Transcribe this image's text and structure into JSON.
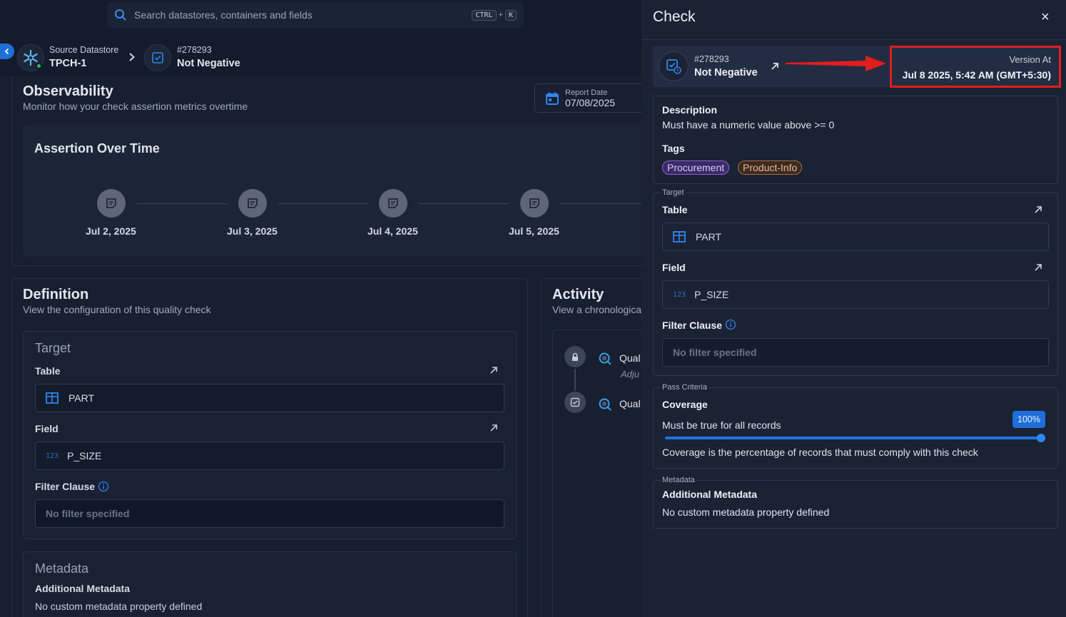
{
  "search": {
    "placeholder": "Search datastores, containers and fields",
    "key1": "CTRL",
    "plus": "+",
    "key2": "K"
  },
  "breadcrumb": {
    "datastore_label": "Source Datastore",
    "datastore_name": "TPCH-1",
    "check_id": "#278293",
    "check_name": "Not Negative"
  },
  "observability": {
    "title": "Observability",
    "subtitle": "Monitor how your check assertion metrics overtime",
    "report_date_label": "Report Date",
    "report_date_value": "07/08/2025",
    "assertion_title": "Assertion Over Time",
    "dates": [
      "Jul 2, 2025",
      "Jul 3, 2025",
      "Jul 4, 2025",
      "Jul 5, 2025"
    ]
  },
  "definition": {
    "title": "Definition",
    "subtitle": "View the configuration of this quality check",
    "target_title": "Target",
    "table_label": "Table",
    "table_value": "PART",
    "field_label": "Field",
    "field_type": "123",
    "field_value": "P_SIZE",
    "filter_label": "Filter Clause",
    "filter_placeholder": "No filter specified",
    "metadata_title": "Metadata",
    "metadata_label": "Additional Metadata",
    "metadata_value": "No custom metadata property defined"
  },
  "activity": {
    "title": "Activity",
    "subtitle": "View a chronologica",
    "item1": "Qual",
    "item1_sub": "Adju",
    "item2": "Qual"
  },
  "panel": {
    "title": "Check",
    "close": "×",
    "check_id": "#278293",
    "check_name": "Not Negative",
    "version_label": "Version At",
    "version_value": "Jul 8 2025, 5:42 AM (GMT+5:30)",
    "description_label": "Description",
    "description_value": "Must have a numeric value above >= 0",
    "tags_label": "Tags",
    "tags": [
      "Procurement",
      "Product-Info"
    ],
    "target_legend": "Target",
    "table_label": "Table",
    "table_value": "PART",
    "field_label": "Field",
    "field_type": "123",
    "field_value": "P_SIZE",
    "filter_label": "Filter Clause",
    "filter_placeholder": "No filter specified",
    "pass_legend": "Pass Criteria",
    "coverage_label": "Coverage",
    "coverage_rule": "Must be true for all records",
    "coverage_percent": "100%",
    "coverage_fraction": 1.0,
    "coverage_note": "Coverage is the percentage of records that must comply with this check",
    "metadata_legend": "Metadata",
    "metadata_label": "Additional Metadata",
    "metadata_value": "No custom metadata property defined"
  },
  "colors": {
    "accent": "#1e6fd9",
    "highlight": "#e11e1e",
    "success": "#2fbf5b"
  }
}
